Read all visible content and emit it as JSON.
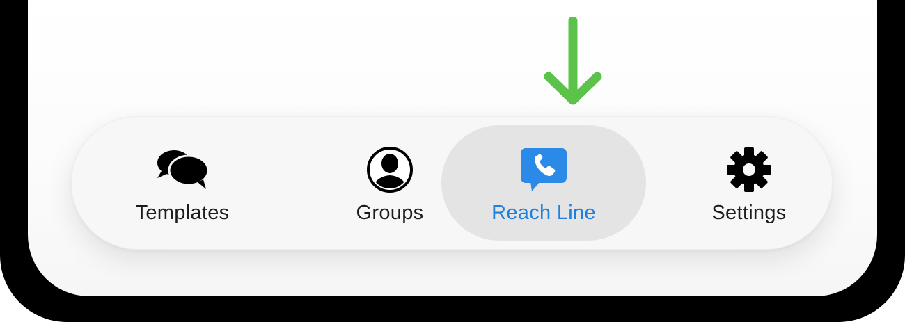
{
  "tabs": [
    {
      "label": "Templates",
      "icon": "chat-bubbles-icon",
      "active": false
    },
    {
      "label": "Groups",
      "icon": "person-circle-icon",
      "active": false
    },
    {
      "label": "Reach Line",
      "icon": "phone-bubble-icon",
      "active": true
    },
    {
      "label": "Settings",
      "icon": "gear-icon",
      "active": false
    }
  ],
  "colors": {
    "active_tab_text": "#1e7fe0",
    "active_tab_background": "#e4e4e4",
    "arrow": "#5cc34a",
    "inactive_text": "#1c1c1c",
    "frame": "#000000"
  },
  "annotation": {
    "icon": "down-arrow-icon",
    "points_to": "Reach Line"
  }
}
